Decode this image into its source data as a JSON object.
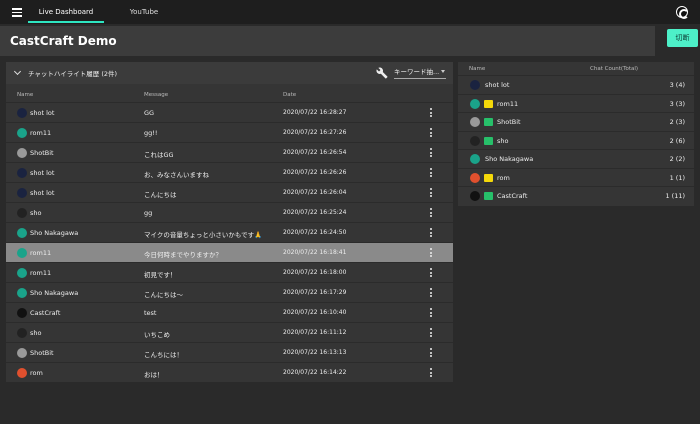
{
  "nav": {
    "tabs": [
      {
        "label": "Live Dashboard"
      },
      {
        "label": "YouTube"
      }
    ]
  },
  "header": {
    "title": "CastCraft Demo",
    "disconnect_label": "切断"
  },
  "highlights": {
    "title": "チャットハイライト履歴 (2件)",
    "keyword_filter": "キーワード抽...",
    "columns": {
      "name": "Name",
      "message": "Message",
      "date": "Date"
    },
    "rows": [
      {
        "name": "shot lot",
        "message": "GG",
        "date": "2020/07/22 16:28:27",
        "avatar": "#1a2340"
      },
      {
        "name": "rom11",
        "message": "gg!!",
        "date": "2020/07/22 16:27:26",
        "avatar": "#1aa38a"
      },
      {
        "name": "ShotBit",
        "message": "これはGG",
        "date": "2020/07/22 16:26:54",
        "avatar": "#9a9a9a"
      },
      {
        "name": "shot lot",
        "message": "お、みなさんいますね",
        "date": "2020/07/22 16:26:26",
        "avatar": "#1a2340"
      },
      {
        "name": "shot lot",
        "message": "こんにちは",
        "date": "2020/07/22 16:26:04",
        "avatar": "#1a2340"
      },
      {
        "name": "sho",
        "message": "gg",
        "date": "2020/07/22 16:25:24",
        "avatar": "#222222"
      },
      {
        "name": "Sho Nakagawa",
        "message": "マイクの音量ちょっと小さいかもです🙏",
        "date": "2020/07/22 16:24:50",
        "avatar": "#1aa38a"
      },
      {
        "name": "rom11",
        "message": "今日何時までやりますか？",
        "date": "2020/07/22 16:18:41",
        "avatar": "#1aa38a",
        "highlighted": true
      },
      {
        "name": "rom11",
        "message": "初見です！",
        "date": "2020/07/22 16:18:00",
        "avatar": "#1aa38a"
      },
      {
        "name": "Sho Nakagawa",
        "message": "こんにちは〜",
        "date": "2020/07/22 16:17:29",
        "avatar": "#1aa38a"
      },
      {
        "name": "CastCraft",
        "message": "test",
        "date": "2020/07/22 16:10:40",
        "avatar": "#111111"
      },
      {
        "name": "sho",
        "message": "いちこめ",
        "date": "2020/07/22 16:11:12",
        "avatar": "#222222"
      },
      {
        "name": "ShotBit",
        "message": "こんちには！",
        "date": "2020/07/22 16:13:13",
        "avatar": "#9a9a9a"
      },
      {
        "name": "rom",
        "message": "おは！",
        "date": "2020/07/22 16:14:22",
        "avatar": "#e0502e"
      }
    ]
  },
  "chat_count": {
    "columns": {
      "name": "Name",
      "count": "Chat Count(Total)"
    },
    "rows": [
      {
        "name": "shot lot",
        "count": "3 (4)",
        "avatar": "#1a2340",
        "badge": ""
      },
      {
        "name": "rom11",
        "count": "3 (3)",
        "avatar": "#1aa38a",
        "badge": "yellow"
      },
      {
        "name": "ShotBit",
        "count": "2 (3)",
        "avatar": "#9a9a9a",
        "badge": "green"
      },
      {
        "name": "sho",
        "count": "2 (6)",
        "avatar": "#222222",
        "badge": "green"
      },
      {
        "name": "Sho Nakagawa",
        "count": "2 (2)",
        "avatar": "#1aa38a",
        "badge": ""
      },
      {
        "name": "rom",
        "count": "1 (1)",
        "avatar": "#e0502e",
        "badge": "yellow"
      },
      {
        "name": "CastCraft",
        "count": "1 (11)",
        "avatar": "#111111",
        "badge": "green"
      }
    ]
  },
  "colors": {
    "accent": "#2ee6c2",
    "button": "#4df0c8",
    "badge_yellow": "#f5d90a",
    "badge_green": "#27c06a"
  }
}
